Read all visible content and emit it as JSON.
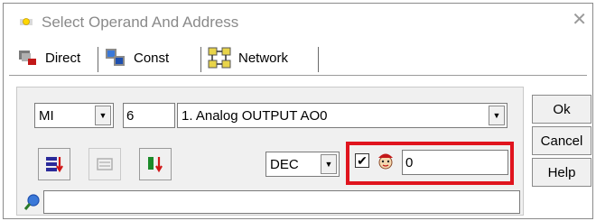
{
  "window": {
    "title": "Select Operand And Address",
    "close_glyph": "✕"
  },
  "tabs": [
    {
      "label": "Direct",
      "icon": "direct-tab-icon"
    },
    {
      "label": "Const",
      "icon": "const-tab-icon"
    },
    {
      "label": "Network",
      "icon": "network-tab-icon"
    }
  ],
  "operand": {
    "type_value": "MI",
    "address_value": "6",
    "description_value": "1. Analog OUTPUT AO0"
  },
  "format": {
    "value": "DEC"
  },
  "indirect": {
    "checked": true,
    "check_glyph": "✔",
    "value": "0",
    "highlight_color": "#e0141e"
  },
  "buttons": {
    "ok": "Ok",
    "cancel": "Cancel",
    "help": "Help"
  },
  "icons": {
    "dropdown_arrow": "▼"
  }
}
